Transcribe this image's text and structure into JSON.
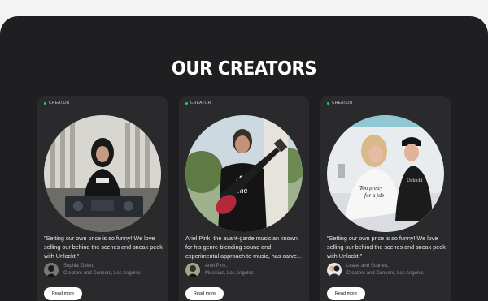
{
  "section": {
    "title": "OUR CREATORS"
  },
  "cards": [
    {
      "tag": "CREATOR",
      "photo_icon": "dj-creator-photo",
      "quote": "\"Setting our own price is so funny! We love selling our behind the scenes and sneak peek with Unlockt.\"",
      "author_name": "Sophia Ziskin,",
      "author_role": "Creators and Dancers, Los Angeles",
      "button": "Read more"
    },
    {
      "tag": "CREATOR",
      "photo_icon": "guitarist-creator-photo",
      "quote": "Ariel Pink, the avant-garde musician known for his genre-blending sound and experimental approach to music, has carve...",
      "author_name": "Ariel Pink,",
      "author_role": "Musician, Los Angeles",
      "button": "Read more"
    },
    {
      "tag": "CREATOR",
      "photo_icon": "duo-creators-photo",
      "quote": "\"Setting our own price is so funny! We love selling our behind the scenes and sneak peek with Unlockt.\"",
      "author_name": "Lease and Scarlett,",
      "author_role": "Creators and Dancers, Los Angeles",
      "button": "Read more"
    }
  ],
  "colors": {
    "page_bg": "#f3f3f4",
    "panel_bg": "#1f1f21",
    "card_bg": "#2a2a2c",
    "status_dot": "#38c566",
    "button_bg": "#ffffff"
  }
}
